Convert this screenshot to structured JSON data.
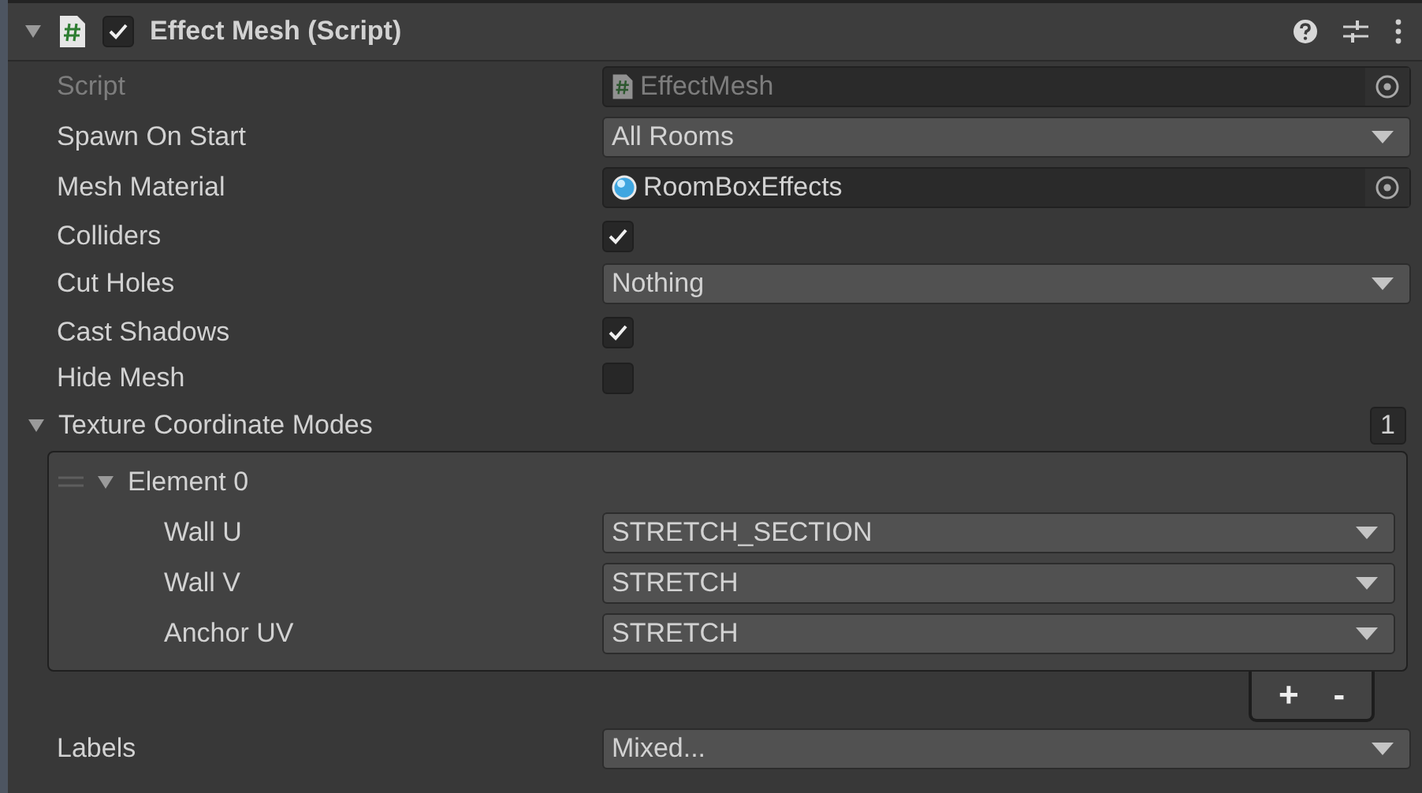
{
  "component": {
    "title": "Effect Mesh (Script)",
    "enabled": true,
    "expanded": true
  },
  "properties": [
    {
      "kind": "script",
      "label": "Script",
      "value": "EffectMesh",
      "disabled": true
    },
    {
      "kind": "dropdown",
      "label": "Spawn On Start",
      "value": "All Rooms"
    },
    {
      "kind": "material",
      "label": "Mesh Material",
      "value": "RoomBoxEffects",
      "disabled": false
    },
    {
      "kind": "checkbox",
      "label": "Colliders",
      "checked": true
    },
    {
      "kind": "dropdown",
      "label": "Cut Holes",
      "value": "Nothing"
    },
    {
      "kind": "checkbox",
      "label": "Cast Shadows",
      "checked": true
    },
    {
      "kind": "checkbox",
      "label": "Hide Mesh",
      "checked": false
    }
  ],
  "array": {
    "label": "Texture Coordinate Modes",
    "expanded": true,
    "count": "1",
    "elements": [
      {
        "label": "Element 0",
        "expanded": true,
        "fields": [
          {
            "label": "Wall U",
            "value": "STRETCH_SECTION"
          },
          {
            "label": "Wall V",
            "value": "STRETCH"
          },
          {
            "label": "Anchor UV",
            "value": "STRETCH"
          }
        ]
      }
    ],
    "add_button": "+",
    "remove_button": "-"
  },
  "labels": {
    "label": "Labels",
    "value": "Mixed..."
  }
}
